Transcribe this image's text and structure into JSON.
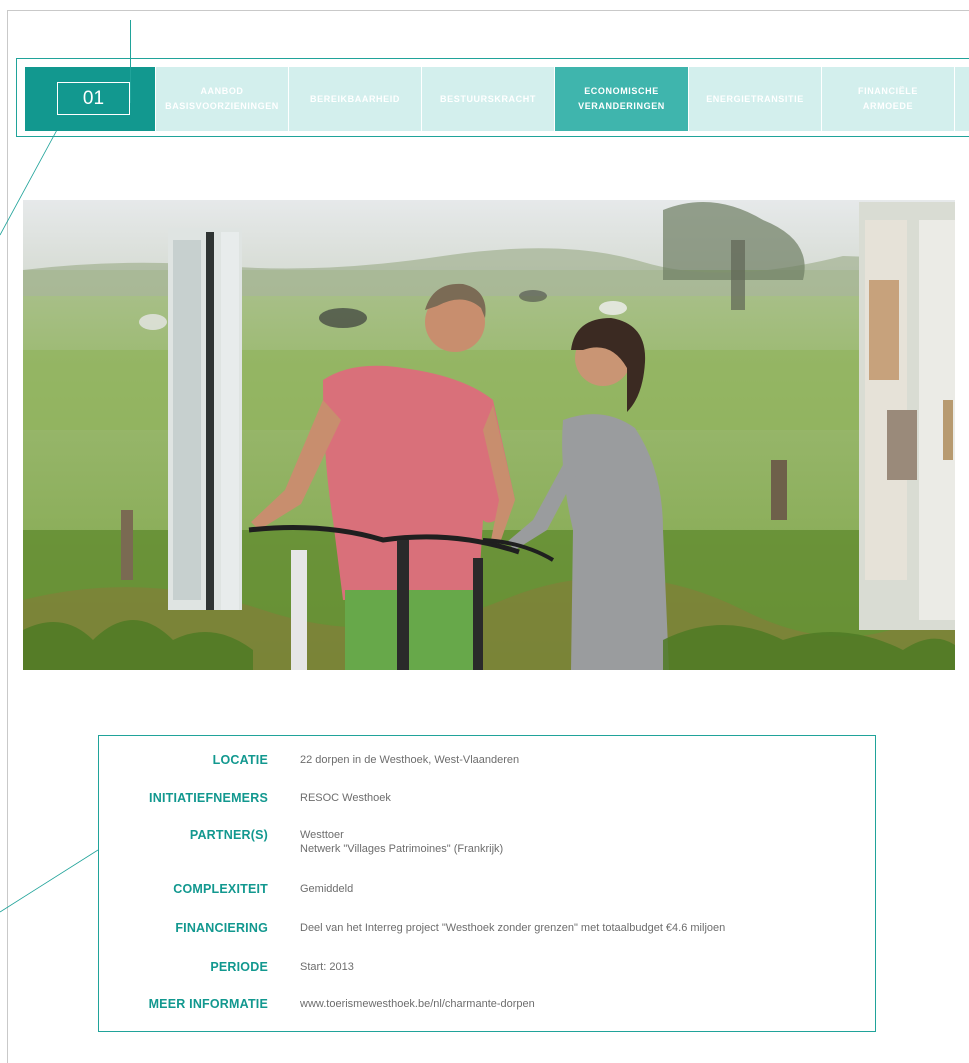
{
  "nav": {
    "number": "01",
    "tabs": [
      {
        "lines": [
          "AANBOD",
          "BASISVOORZIENINGEN"
        ],
        "active": false
      },
      {
        "lines": [
          "BEREIKBAARHEID"
        ],
        "active": false
      },
      {
        "lines": [
          "BESTUURSKRACHT"
        ],
        "active": false
      },
      {
        "lines": [
          "ECONOMISCHE",
          "VERANDERINGEN"
        ],
        "active": true
      },
      {
        "lines": [
          "ENERGIETRANSITIE"
        ],
        "active": false
      },
      {
        "lines": [
          "FINANCIËLE",
          "ARMOEDE"
        ],
        "active": false
      }
    ]
  },
  "colors": {
    "accent": "#12988f",
    "accent_border": "#20a39a",
    "tab_inactive": "#d3efed",
    "tab_active": "#3fb5ad"
  },
  "info": {
    "rows": [
      {
        "label": "LOCATIE",
        "value": [
          "22 dorpen in de Westhoek, West-Vlaanderen"
        ]
      },
      {
        "label": "INITIATIEFNEMERS",
        "value": [
          "RESOC Westhoek"
        ]
      },
      {
        "label": "PARTNER(S)",
        "value": [
          "Westtoer",
          "Netwerk \"Villages Patrimoines\" (Frankrijk)"
        ]
      },
      {
        "label": "COMPLEXITEIT",
        "value": [
          "Gemiddeld"
        ]
      },
      {
        "label": "FINANCIERING",
        "value": [
          "Deel van het Interreg project \"Westhoek zonder grenzen\" met totaalbudget €4.6 miljoen"
        ]
      },
      {
        "label": "PERIODE",
        "value": [
          "Start: 2013"
        ]
      },
      {
        "label": "MEER INFORMATIE",
        "value": [
          "www.toerismewesthoek.be/nl/charmante-dorpen"
        ]
      }
    ]
  }
}
